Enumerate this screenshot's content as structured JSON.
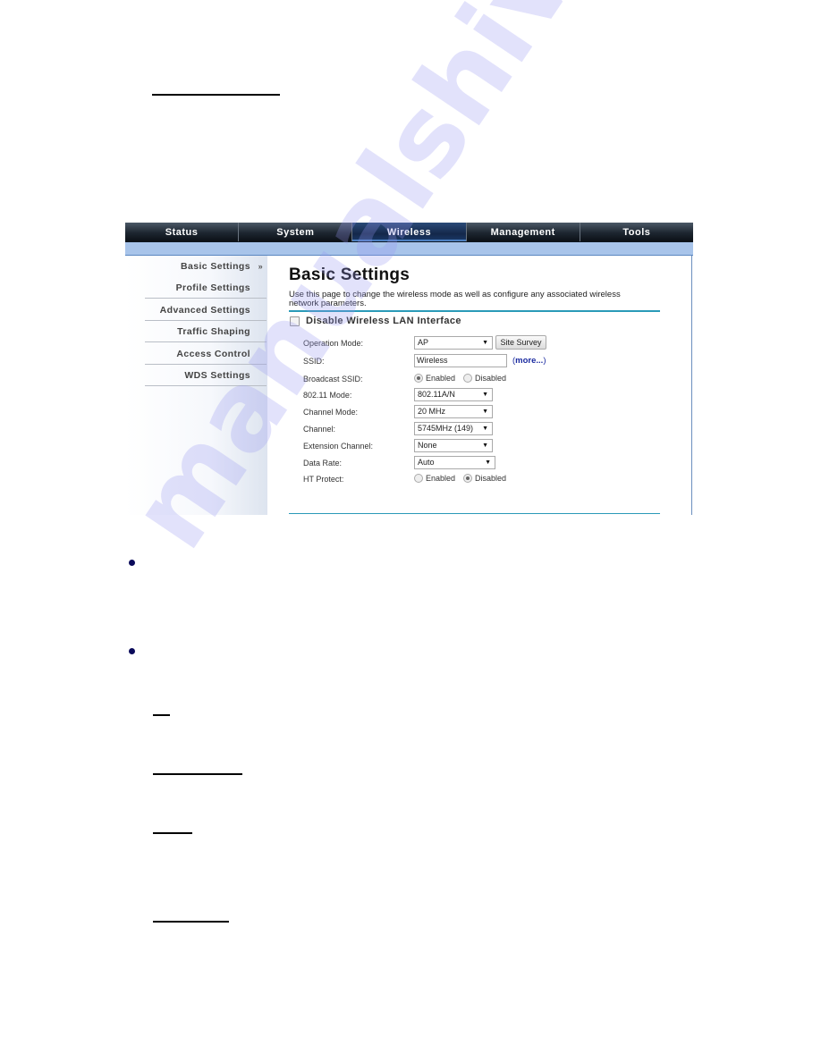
{
  "document": {
    "watermark": "manualshive.com"
  },
  "router_ui": {
    "nav_tabs": [
      {
        "label": "Status",
        "active": false
      },
      {
        "label": "System",
        "active": false
      },
      {
        "label": "Wireless",
        "active": true
      },
      {
        "label": "Management",
        "active": false
      },
      {
        "label": "Tools",
        "active": false
      }
    ],
    "sidebar": {
      "items": [
        {
          "label": "Basic Settings",
          "active": true,
          "marker": "»"
        },
        {
          "label": "Profile Settings"
        },
        {
          "label": "Advanced Settings"
        },
        {
          "label": "Traffic Shaping"
        },
        {
          "label": "Access Control"
        },
        {
          "label": "WDS Settings"
        }
      ]
    },
    "main": {
      "title": "Basic Settings",
      "description": "Use this page to change the wireless mode as well as configure any associated wireless network parameters.",
      "disable_wlan_label": "Disable Wireless LAN Interface",
      "disable_wlan_checked": false,
      "fields": {
        "operation_mode": {
          "label": "Operation Mode:",
          "value": "AP",
          "button": "Site Survey"
        },
        "ssid": {
          "label": "SSID:",
          "value": "Wireless",
          "link_open": "(",
          "link": "more...",
          "link_close": ")"
        },
        "broadcast_ssid": {
          "label": "Broadcast SSID:",
          "options": [
            "Enabled",
            "Disabled"
          ],
          "selected": "Enabled"
        },
        "mode_80211": {
          "label": "802.11 Mode:",
          "value": "802.11A/N"
        },
        "channel_mode": {
          "label": "Channel Mode:",
          "value": "20 MHz"
        },
        "channel": {
          "label": "Channel:",
          "value": "5745MHz (149)"
        },
        "extension_channel": {
          "label": "Extension Channel:",
          "value": "None"
        },
        "data_rate": {
          "label": "Data Rate:",
          "value": "Auto"
        },
        "ht_protect": {
          "label": "HT Protect:",
          "options": [
            "Enabled",
            "Disabled"
          ],
          "selected": "Disabled"
        }
      },
      "dropdown_arrow": "▼"
    }
  }
}
